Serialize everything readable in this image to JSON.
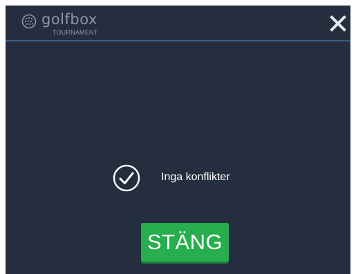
{
  "header": {
    "logo": {
      "wordmark": "golfbox",
      "subtitle": "TOURNAMENT",
      "icon": "golf-ball-icon"
    },
    "close_icon": "close-icon"
  },
  "status": {
    "icon": "check-circle-icon",
    "message": "Inga konflikter"
  },
  "actions": {
    "close_label": "STÄNG"
  },
  "colors": {
    "background": "#252e3e",
    "header_divider": "#3a5f87",
    "logo": "#8d96a6",
    "button": "#27ae4e",
    "text": "#ffffff"
  }
}
